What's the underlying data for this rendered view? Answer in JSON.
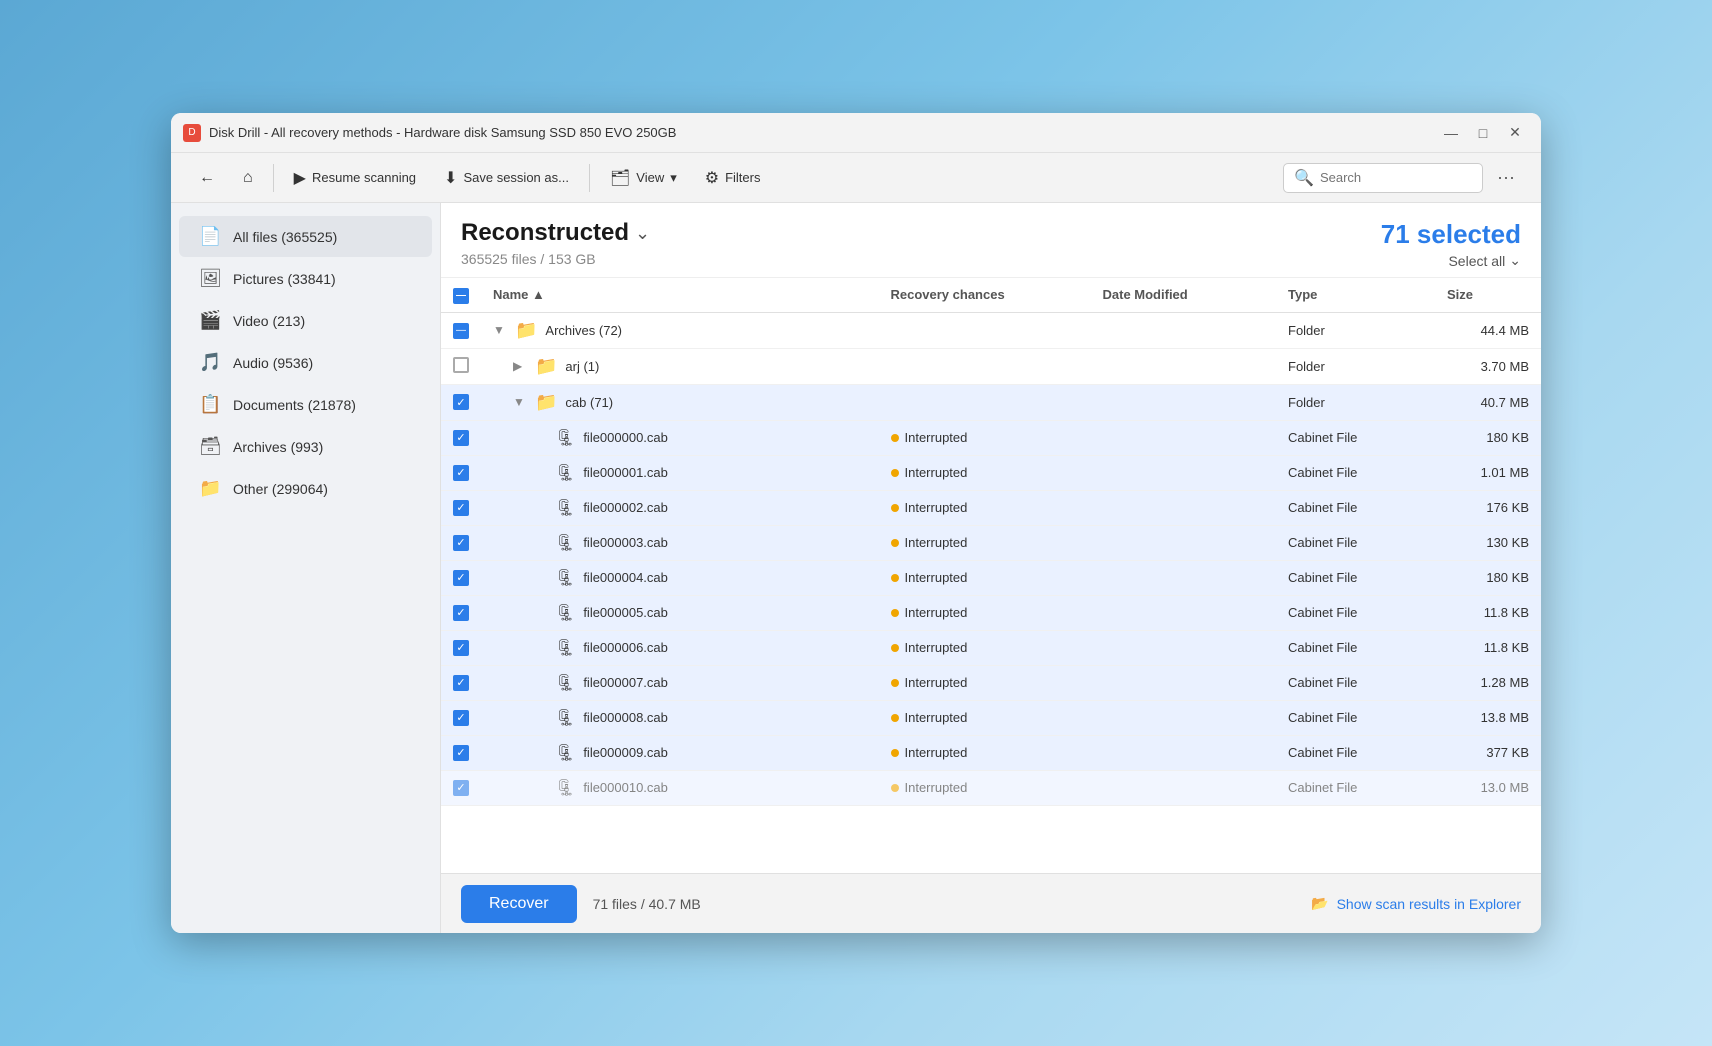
{
  "titleBar": {
    "title": "Disk Drill - All recovery methods - Hardware disk Samsung SSD 850 EVO 250GB",
    "minimize": "—",
    "maximize": "□",
    "close": "✕"
  },
  "toolbar": {
    "back": "←",
    "home": "⌂",
    "resume": "▶",
    "resumeLabel": "Resume scanning",
    "save": "⬇",
    "saveLabel": "Save session as...",
    "view": "🗂",
    "viewLabel": "View",
    "filters": "⚙",
    "filtersLabel": "Filters",
    "search": "🔍",
    "searchPlaceholder": "Search",
    "more": "···"
  },
  "sidebar": {
    "items": [
      {
        "id": "all-files",
        "icon": "📄",
        "label": "All files (365525)",
        "active": true
      },
      {
        "id": "pictures",
        "icon": "🖼",
        "label": "Pictures (33841)",
        "active": false
      },
      {
        "id": "video",
        "icon": "🎬",
        "label": "Video (213)",
        "active": false
      },
      {
        "id": "audio",
        "icon": "🎵",
        "label": "Audio (9536)",
        "active": false
      },
      {
        "id": "documents",
        "icon": "📋",
        "label": "Documents (21878)",
        "active": false
      },
      {
        "id": "archives",
        "icon": "🗃",
        "label": "Archives (993)",
        "active": false
      },
      {
        "id": "other",
        "icon": "📁",
        "label": "Other (299064)",
        "active": false
      }
    ]
  },
  "contentHeader": {
    "title": "Reconstructed",
    "chevron": "⌄",
    "subtitle": "365525 files / 153 GB",
    "selectedCount": "71 selected",
    "selectAllLabel": "Select all",
    "selectAllChevron": "⌄"
  },
  "tableColumns": {
    "name": "Name",
    "recovery": "Recovery chances",
    "date": "Date Modified",
    "type": "Type",
    "size": "Size"
  },
  "rows": [
    {
      "id": "archives-folder",
      "indent": 0,
      "checkbox": "intermediate",
      "expandable": true,
      "expanded": true,
      "isFolder": true,
      "name": "Archives (72)",
      "recovery": "",
      "date": "",
      "type": "Folder",
      "size": "44.4 MB"
    },
    {
      "id": "arj-folder",
      "indent": 1,
      "checkbox": "unchecked",
      "expandable": true,
      "expanded": false,
      "isFolder": true,
      "name": "arj (1)",
      "recovery": "",
      "date": "",
      "type": "Folder",
      "size": "3.70 MB"
    },
    {
      "id": "cab-folder",
      "indent": 1,
      "checkbox": "checked",
      "expandable": true,
      "expanded": true,
      "isFolder": true,
      "name": "cab (71)",
      "recovery": "",
      "date": "",
      "type": "Folder",
      "size": "40.7 MB",
      "selected": true
    },
    {
      "id": "file000000",
      "indent": 2,
      "checkbox": "checked",
      "expandable": false,
      "expanded": false,
      "isFolder": false,
      "name": "file000000.cab",
      "recovery": "Interrupted",
      "recoveryDot": "interrupted",
      "date": "",
      "type": "Cabinet File",
      "size": "180 KB",
      "selected": true
    },
    {
      "id": "file000001",
      "indent": 2,
      "checkbox": "checked",
      "expandable": false,
      "expanded": false,
      "isFolder": false,
      "name": "file000001.cab",
      "recovery": "Interrupted",
      "recoveryDot": "interrupted",
      "date": "",
      "type": "Cabinet File",
      "size": "1.01 MB",
      "selected": true
    },
    {
      "id": "file000002",
      "indent": 2,
      "checkbox": "checked",
      "expandable": false,
      "expanded": false,
      "isFolder": false,
      "name": "file000002.cab",
      "recovery": "Interrupted",
      "recoveryDot": "interrupted",
      "date": "",
      "type": "Cabinet File",
      "size": "176 KB",
      "selected": true
    },
    {
      "id": "file000003",
      "indent": 2,
      "checkbox": "checked",
      "expandable": false,
      "expanded": false,
      "isFolder": false,
      "name": "file000003.cab",
      "recovery": "Interrupted",
      "recoveryDot": "interrupted",
      "date": "",
      "type": "Cabinet File",
      "size": "130 KB",
      "selected": true
    },
    {
      "id": "file000004",
      "indent": 2,
      "checkbox": "checked",
      "expandable": false,
      "expanded": false,
      "isFolder": false,
      "name": "file000004.cab",
      "recovery": "Interrupted",
      "recoveryDot": "interrupted",
      "date": "",
      "type": "Cabinet File",
      "size": "180 KB",
      "selected": true
    },
    {
      "id": "file000005",
      "indent": 2,
      "checkbox": "checked",
      "expandable": false,
      "expanded": false,
      "isFolder": false,
      "name": "file000005.cab",
      "recovery": "Interrupted",
      "recoveryDot": "interrupted",
      "date": "",
      "type": "Cabinet File",
      "size": "11.8 KB",
      "selected": true
    },
    {
      "id": "file000006",
      "indent": 2,
      "checkbox": "checked",
      "expandable": false,
      "expanded": false,
      "isFolder": false,
      "name": "file000006.cab",
      "recovery": "Interrupted",
      "recoveryDot": "interrupted",
      "date": "",
      "type": "Cabinet File",
      "size": "11.8 KB",
      "selected": true
    },
    {
      "id": "file000007",
      "indent": 2,
      "checkbox": "checked",
      "expandable": false,
      "expanded": false,
      "isFolder": false,
      "name": "file000007.cab",
      "recovery": "Interrupted",
      "recoveryDot": "interrupted",
      "date": "",
      "type": "Cabinet File",
      "size": "1.28 MB",
      "selected": true
    },
    {
      "id": "file000008",
      "indent": 2,
      "checkbox": "checked",
      "expandable": false,
      "expanded": false,
      "isFolder": false,
      "name": "file000008.cab",
      "recovery": "Interrupted",
      "recoveryDot": "interrupted",
      "date": "",
      "type": "Cabinet File",
      "size": "13.8 MB",
      "selected": true
    },
    {
      "id": "file000009",
      "indent": 2,
      "checkbox": "checked",
      "expandable": false,
      "expanded": false,
      "isFolder": false,
      "name": "file000009.cab",
      "recovery": "Interrupted",
      "recoveryDot": "interrupted",
      "date": "",
      "type": "Cabinet File",
      "size": "377 KB",
      "selected": true
    },
    {
      "id": "file000010",
      "indent": 2,
      "checkbox": "checked",
      "expandable": false,
      "expanded": false,
      "isFolder": false,
      "name": "file000010.cab",
      "recovery": "Interrupted",
      "recoveryDot": "interrupted",
      "date": "",
      "type": "Cabinet File",
      "size": "13.0 MB",
      "selected": true,
      "partial": true
    }
  ],
  "bottomBar": {
    "recoverLabel": "Recover",
    "fileInfo": "71 files / 40.7 MB",
    "showExplorerLabel": "Show scan results in Explorer"
  }
}
